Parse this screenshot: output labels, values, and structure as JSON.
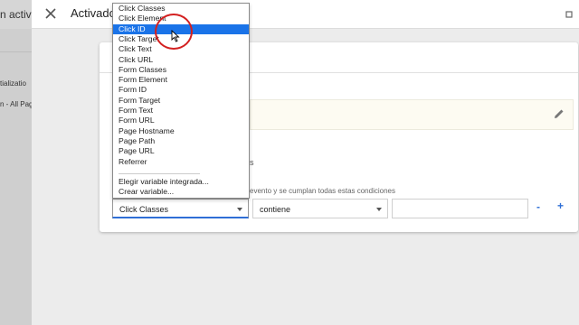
{
  "background": {
    "fragments": [
      "n activa",
      "tializatio",
      "n - All Pag"
    ]
  },
  "sheet": {
    "title": "Activado",
    "close_icon": "close-icon",
    "right_icon": "more-icon"
  },
  "card": {
    "pencil_icon": "pencil-icon",
    "fragment_s": "s",
    "condition_text": "evento y se cumplan todas estas condiciones"
  },
  "condition_row": {
    "variable_value": "Click Classes",
    "operator_value": "contiene",
    "value_placeholder": "",
    "remove_label": "-",
    "add_label": "+"
  },
  "dropdown": {
    "items": [
      "Click Classes",
      "Click Element",
      "Click ID",
      "Click Target",
      "Click Text",
      "Click URL",
      "Form Classes",
      "Form Element",
      "Form ID",
      "Form Target",
      "Form Text",
      "Form URL",
      "Page Hostname",
      "Page Path",
      "Page URL",
      "Referrer"
    ],
    "selected_index": 2,
    "actions": [
      "Elegir variable integrada...",
      "Crear variable..."
    ]
  },
  "colors": {
    "accent": "#1a73e8",
    "annotation": "#d32020"
  }
}
